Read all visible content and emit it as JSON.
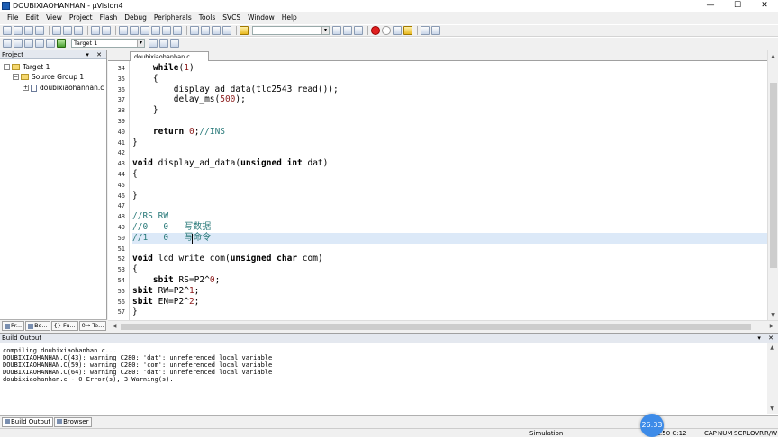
{
  "window": {
    "title": "DOUBIXIAOHANHAN - µVision4",
    "minimize": "—",
    "maximize": "☐",
    "close": "✕"
  },
  "menu": [
    "File",
    "Edit",
    "View",
    "Project",
    "Flash",
    "Debug",
    "Peripherals",
    "Tools",
    "SVCS",
    "Window",
    "Help"
  ],
  "toolbar2": {
    "target_select": "Target 1"
  },
  "project_panel": {
    "title": "Project",
    "tree": [
      {
        "label": "Target 1",
        "level": 0,
        "expander": "−"
      },
      {
        "label": "Source Group 1",
        "level": 1,
        "expander": "−"
      },
      {
        "label": "doubixiaohanhan.c",
        "level": 2,
        "expander": "+"
      }
    ],
    "tabs": [
      "Pr...",
      "Bo...",
      "{} Fu...",
      "0→ Te..."
    ]
  },
  "editor": {
    "tab_label": "doubixiaohanhan.c",
    "tab_close": "×",
    "lines": [
      {
        "n": "34",
        "parts": [
          [
            "",
            "    "
          ],
          [
            "kw",
            "while"
          ],
          [
            "",
            "("
          ],
          [
            "num",
            "1"
          ],
          [
            "",
            ")"
          ]
        ]
      },
      {
        "n": "35",
        "parts": [
          [
            "",
            "    {"
          ]
        ]
      },
      {
        "n": "36",
        "parts": [
          [
            "",
            "        display_ad_data(tlc2543_read());"
          ]
        ]
      },
      {
        "n": "37",
        "parts": [
          [
            "",
            "        delay_ms("
          ],
          [
            "num",
            "500"
          ],
          [
            "",
            ");"
          ]
        ]
      },
      {
        "n": "38",
        "parts": [
          [
            "",
            "    }"
          ]
        ]
      },
      {
        "n": "39",
        "parts": []
      },
      {
        "n": "40",
        "parts": [
          [
            "",
            "    "
          ],
          [
            "kw",
            "return"
          ],
          [
            "",
            " "
          ],
          [
            "num",
            "0"
          ],
          [
            "",
            ";"
          ],
          [
            "cmt",
            "//INS"
          ]
        ]
      },
      {
        "n": "41",
        "parts": [
          [
            "",
            "}"
          ]
        ]
      },
      {
        "n": "42",
        "parts": []
      },
      {
        "n": "43",
        "parts": [
          [
            "kw",
            "void"
          ],
          [
            "",
            " display_ad_data("
          ],
          [
            "kw",
            "unsigned int"
          ],
          [
            "",
            " dat)"
          ]
        ]
      },
      {
        "n": "44",
        "parts": [
          [
            "",
            "{"
          ]
        ]
      },
      {
        "n": "45",
        "parts": []
      },
      {
        "n": "46",
        "parts": [
          [
            "",
            "}"
          ]
        ]
      },
      {
        "n": "47",
        "parts": []
      },
      {
        "n": "48",
        "parts": [
          [
            "cmt",
            "//RS RW"
          ]
        ]
      },
      {
        "n": "49",
        "parts": [
          [
            "cmt",
            "//0   0   "
          ],
          [
            "cmt cjk",
            "写数据"
          ]
        ]
      },
      {
        "n": "50",
        "parts": [
          [
            "cmt",
            "//1   0   "
          ],
          [
            "cmt cjk",
            "写命令"
          ]
        ],
        "highlight": true
      },
      {
        "n": "51",
        "parts": []
      },
      {
        "n": "52",
        "parts": [
          [
            "kw",
            "void"
          ],
          [
            "",
            " lcd_write_com("
          ],
          [
            "kw",
            "unsigned char"
          ],
          [
            "",
            " com)"
          ]
        ]
      },
      {
        "n": "53",
        "parts": [
          [
            "",
            "{"
          ]
        ]
      },
      {
        "n": "54",
        "parts": [
          [
            "",
            "    "
          ],
          [
            "kw",
            "sbit"
          ],
          [
            "",
            " RS=P2^"
          ],
          [
            "num",
            "0"
          ],
          [
            "",
            ";"
          ]
        ]
      },
      {
        "n": "55",
        "parts": [
          [
            "kw",
            "sbit"
          ],
          [
            "",
            " RW=P2^"
          ],
          [
            "num",
            "1"
          ],
          [
            "",
            ";"
          ]
        ]
      },
      {
        "n": "56",
        "parts": [
          [
            "kw",
            "sbit"
          ],
          [
            "",
            " EN=P2^"
          ],
          [
            "num",
            "2"
          ],
          [
            "",
            ";"
          ]
        ]
      },
      {
        "n": "57",
        "parts": [
          [
            "",
            "}"
          ]
        ]
      }
    ]
  },
  "build_output": {
    "title": "Build Output",
    "lines": [
      "compiling doubixiaohanhan.c...",
      "DOUBIXIAOHANHAN.C(43): warning C280: 'dat': unreferenced local variable",
      "DOUBIXIAOHANHAN.C(59): warning C280: 'com': unreferenced local variable",
      "DOUBIXIAOHANHAN.C(64): warning C280: 'dat': unreferenced local variable",
      "doubixiaohanhan.c - 0 Error(s), 3 Warning(s)."
    ],
    "tabs": [
      "Build Output",
      "Browser"
    ]
  },
  "status": {
    "mode": "Simulation",
    "position": "L:50 C:12",
    "indicators": [
      "CAP",
      "NUM",
      "SCRL",
      "OVR",
      "R/W"
    ]
  },
  "overlay": {
    "time": "26:33"
  },
  "colors": {
    "accent": "#3d8be8",
    "highlight_line": "#dce9f8",
    "comment": "#2a7a7a",
    "number": "#8b1a1a"
  }
}
